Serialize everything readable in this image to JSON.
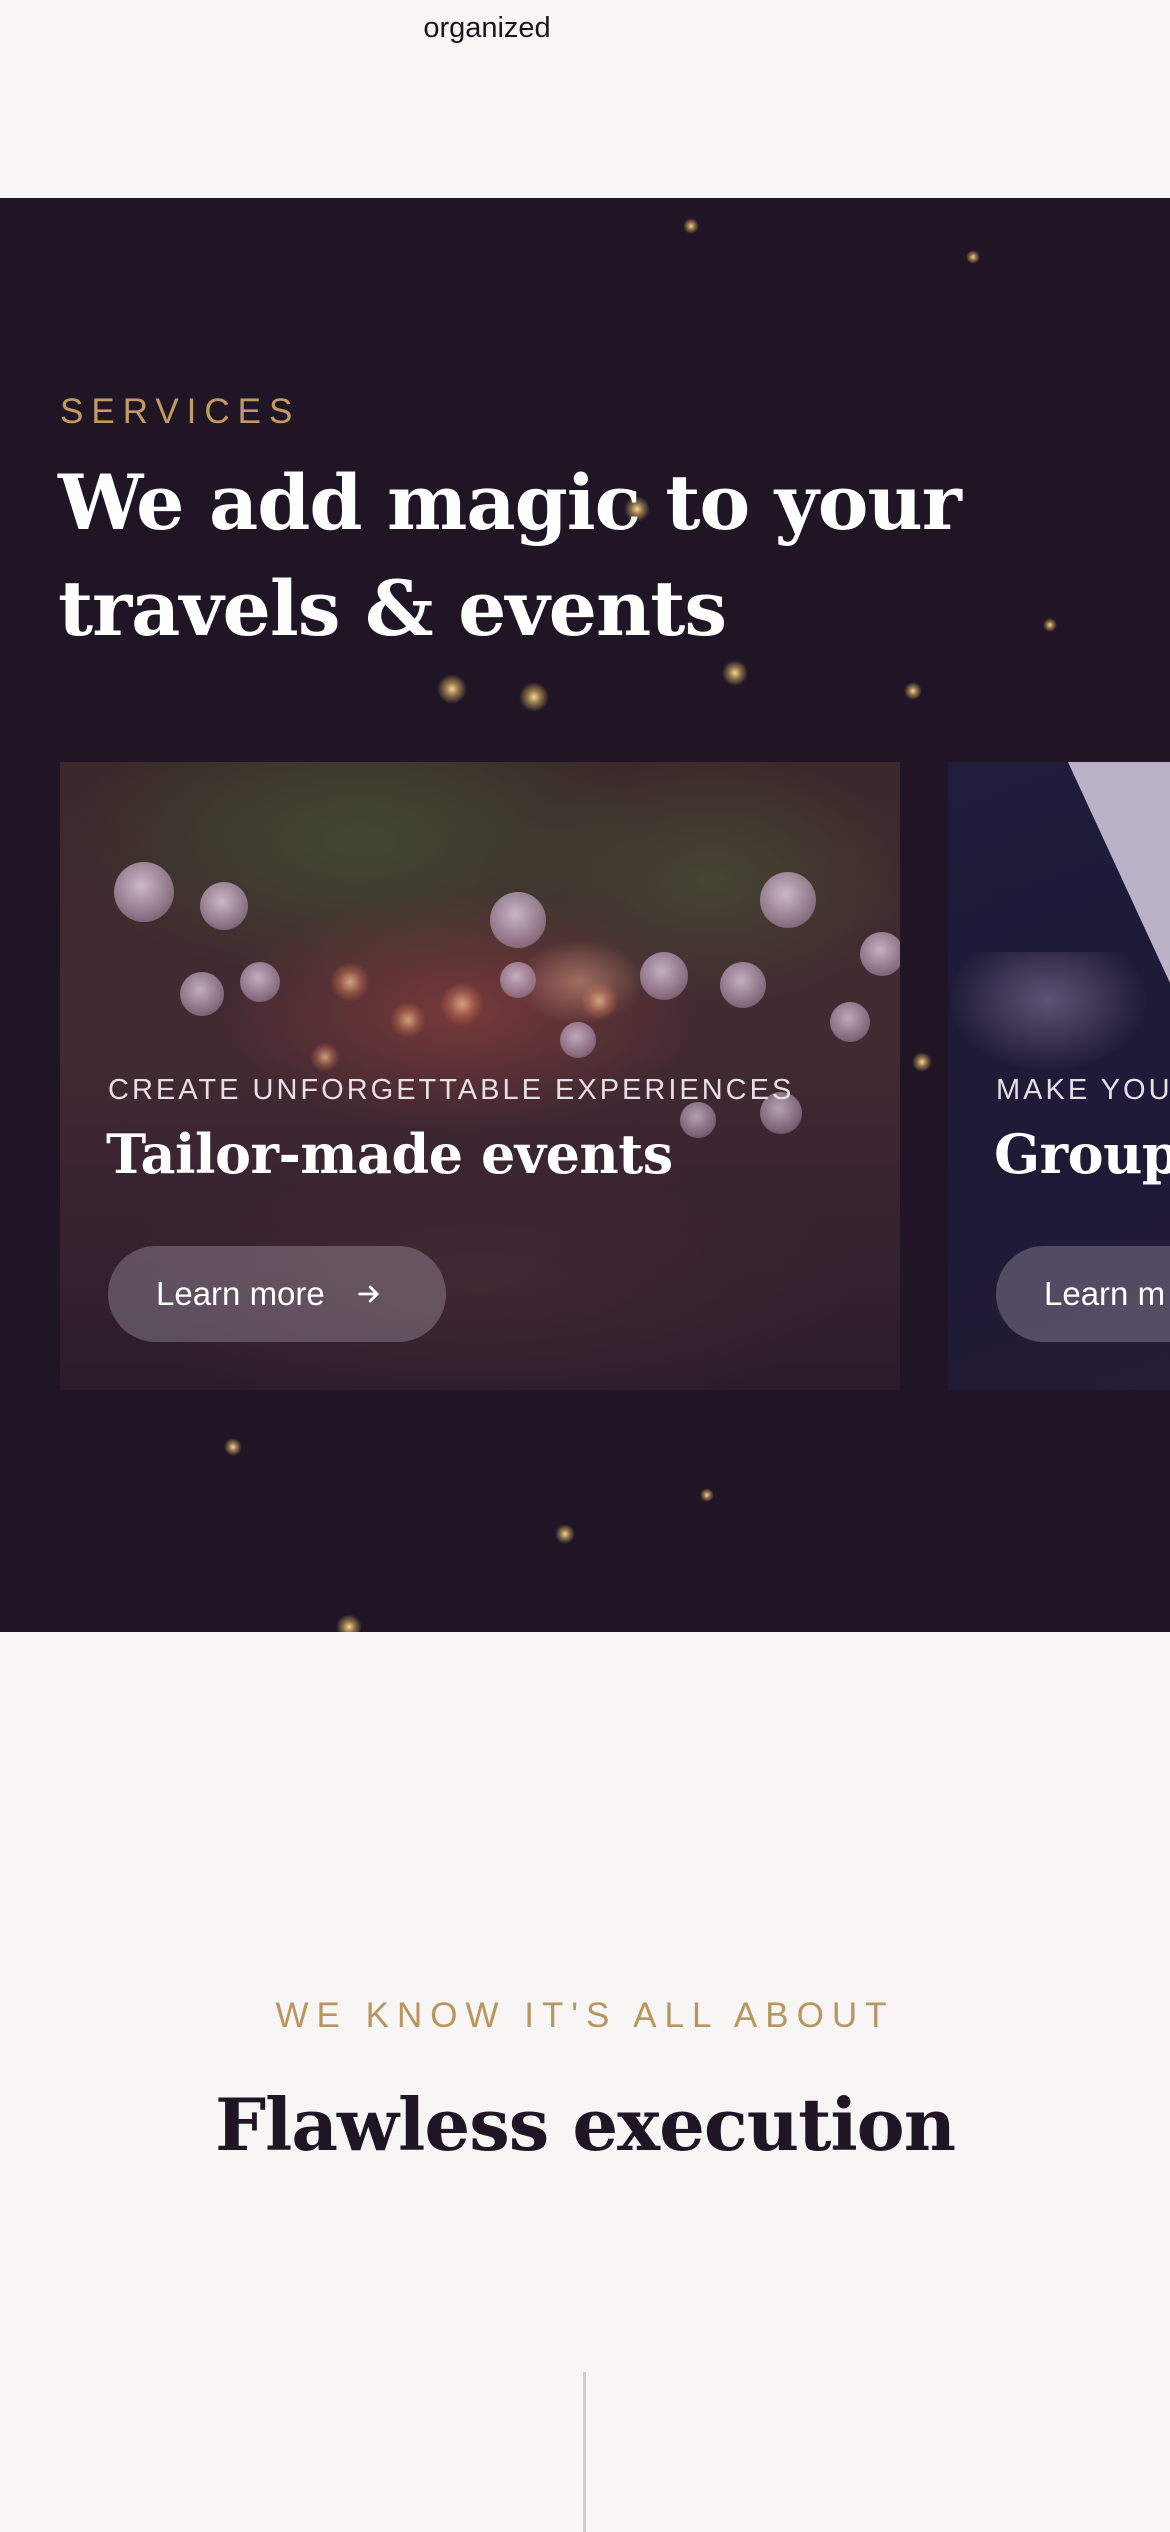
{
  "top": {
    "text": "organized"
  },
  "services": {
    "eyebrow": "SERVICES",
    "title": "We add magic to your travels & events",
    "cards": [
      {
        "eyebrow": "CREATE UNFORGETTABLE EXPERIENCES",
        "title": "Tailor-made events",
        "button_label": "Learn more",
        "button_icon": "arrow-right-icon"
      },
      {
        "eyebrow": "MAKE YOU",
        "title": "Groups",
        "button_label": "Learn m",
        "button_icon": "arrow-right-icon"
      }
    ]
  },
  "flawless": {
    "eyebrow": "WE KNOW IT'S ALL ABOUT",
    "title": "Flawless execution"
  },
  "colors": {
    "dark_background": "#1f1524",
    "light_background": "#f7f6f4",
    "accent_gold": "#c29a62",
    "heading_dark": "#1f1524"
  }
}
